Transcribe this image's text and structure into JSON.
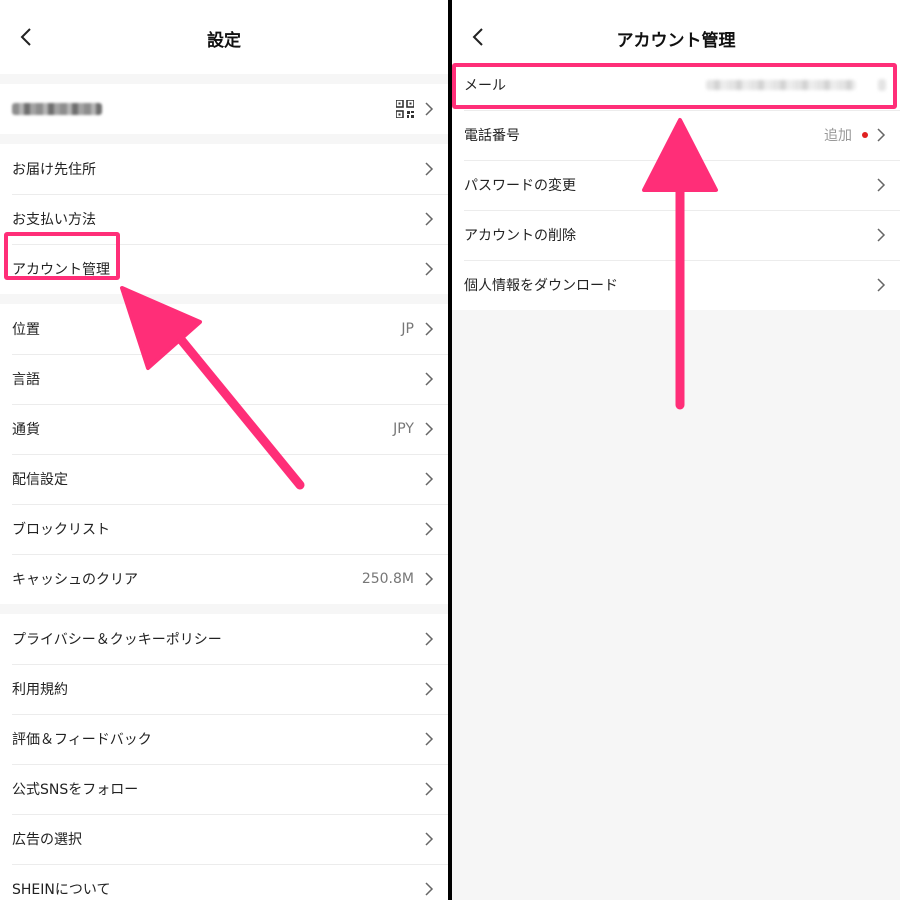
{
  "left": {
    "title": "設定",
    "qr_icon": "qr-code-icon",
    "groups": [
      [
        {
          "label": "お届け先住所"
        },
        {
          "label": "お支払い方法"
        },
        {
          "label": "アカウント管理"
        }
      ],
      [
        {
          "label": "位置",
          "value": "JP"
        },
        {
          "label": "言語"
        },
        {
          "label": "通貨",
          "value": "JPY"
        },
        {
          "label": "配信設定"
        },
        {
          "label": "ブロックリスト"
        },
        {
          "label": "キャッシュのクリア",
          "value": "250.8M"
        }
      ],
      [
        {
          "label": "プライバシー＆クッキーポリシー"
        },
        {
          "label": "利用規約"
        },
        {
          "label": "評価＆フィードバック"
        },
        {
          "label": "公式SNSをフォロー"
        },
        {
          "label": "広告の選択"
        },
        {
          "label": "SHEINについて"
        }
      ]
    ]
  },
  "right": {
    "title": "アカウント管理",
    "rows": [
      {
        "label": "メール"
      },
      {
        "label": "電話番号",
        "value": "追加"
      },
      {
        "label": "パスワードの変更"
      },
      {
        "label": "アカウントの削除"
      },
      {
        "label": "個人情報をダウンロード"
      }
    ]
  },
  "colors": {
    "highlight": "#ff2e78",
    "badge_dot": "#e02020",
    "background": "#f6f6f6"
  }
}
